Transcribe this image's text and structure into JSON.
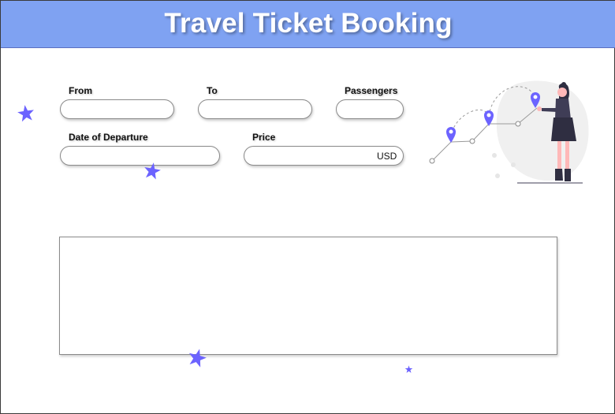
{
  "header": {
    "title": "Travel Ticket Booking"
  },
  "form": {
    "from_label": "From",
    "to_label": "To",
    "passengers_label": "Passengers",
    "departure_label": "Date of Departure",
    "price_label": "Price",
    "price_unit": "USD"
  },
  "icons": {
    "decorative_stars": "star-icon",
    "illustration": "traveler-map-pins-illustration",
    "map_pin": "map-pin-icon"
  },
  "colors": {
    "banner": "#7fa2f2",
    "accent": "#6c63ff",
    "figure_dark": "#3f3d56",
    "blob": "#f0f0f0"
  }
}
